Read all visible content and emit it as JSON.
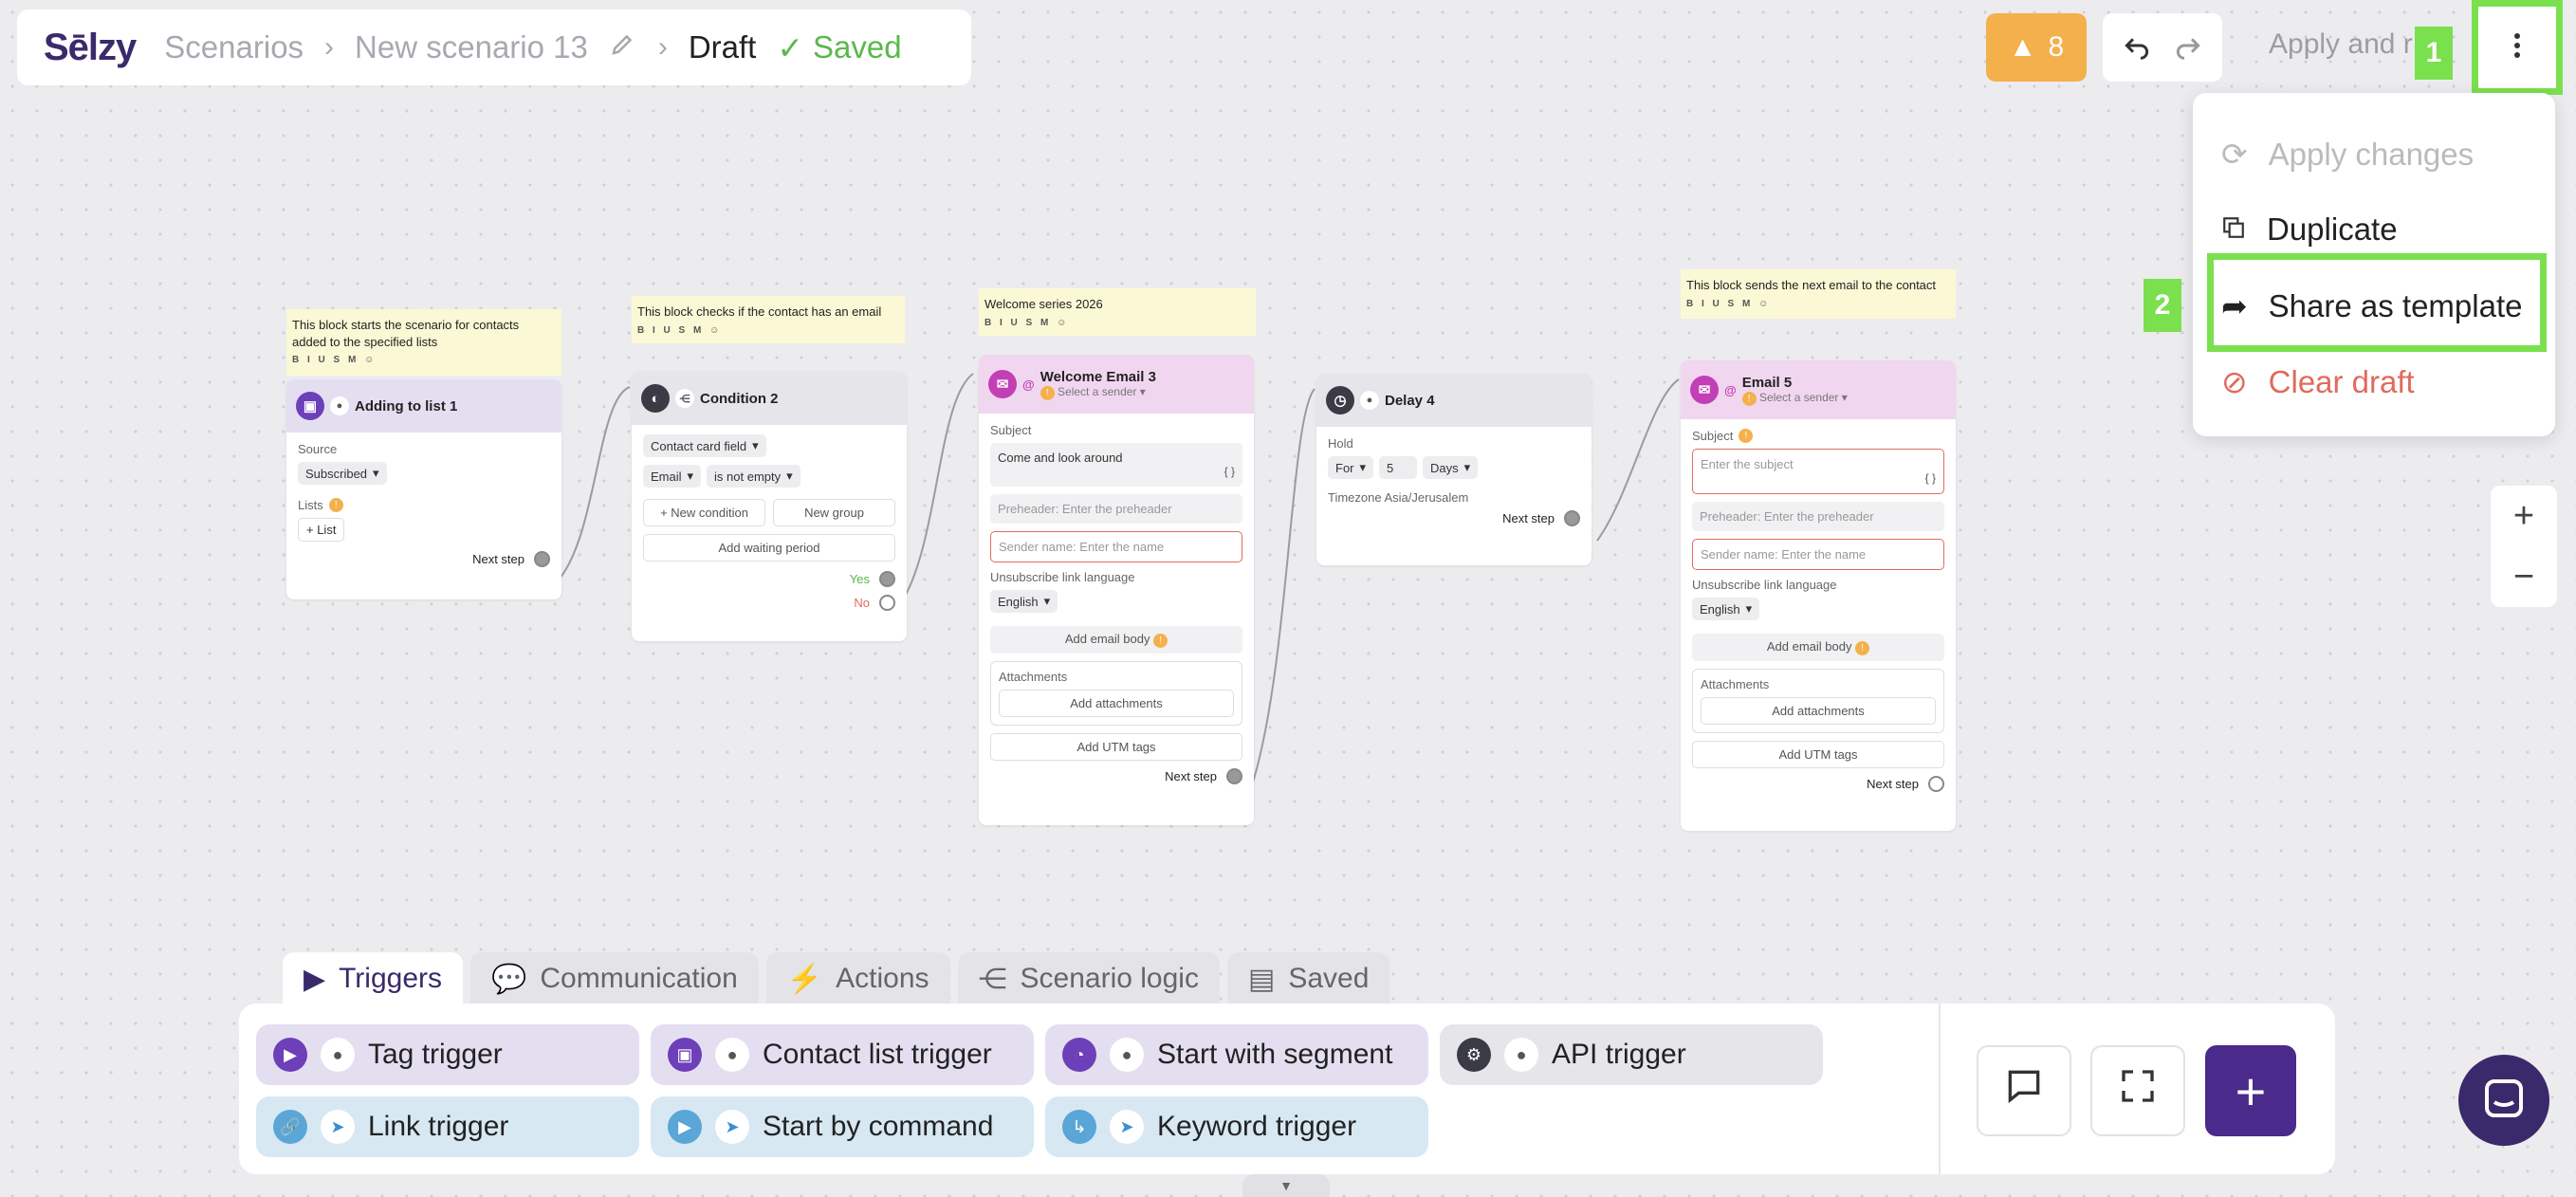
{
  "header": {
    "logo": "Sēlzy",
    "breadcrumb_scenarios": "Scenarios",
    "scenario_name": "New scenario 13",
    "status_draft": "Draft",
    "status_saved": "Saved",
    "warnings_count": "8",
    "apply_label": "Apply and r"
  },
  "annotations": {
    "step1": "1",
    "step2": "2"
  },
  "menu": {
    "apply_changes": "Apply changes",
    "duplicate": "Duplicate",
    "share_as_template": "Share as template",
    "clear_draft": "Clear draft"
  },
  "zoom": {
    "in": "+",
    "out": "−"
  },
  "note_tools": "B I U S M ☺",
  "blocks": {
    "list": {
      "note": "This block starts the scenario for contacts added to the specified lists",
      "title": "Adding to list 1",
      "source_label": "Source",
      "source_value": "Subscribed",
      "lists_label": "Lists",
      "add_list": "+ List",
      "next": "Next step"
    },
    "condition": {
      "note": "This block checks if the contact has an email",
      "title": "Condition 2",
      "field": "Contact card field",
      "subfield": "Email",
      "operator": "is not empty",
      "new_condition": "+ New condition",
      "new_group": "New group",
      "add_wait": "Add waiting period",
      "yes": "Yes",
      "no": "No"
    },
    "email3": {
      "note": "Welcome series 2026",
      "title": "Welcome Email 3",
      "sender": "Select a sender",
      "subject_label": "Subject",
      "subject_value": "Come and look around",
      "preheader": "Preheader: Enter the preheader",
      "sender_name": "Sender name: Enter the name",
      "unsub_label": "Unsubscribe link language",
      "lang": "English",
      "add_body": "Add email body",
      "attachments": "Attachments",
      "add_attachments": "Add attachments",
      "utm": "Add UTM tags",
      "next": "Next step"
    },
    "delay": {
      "title": "Delay 4",
      "hold_label": "Hold",
      "for": "For",
      "amount": "5",
      "unit": "Days",
      "timezone": "Timezone Asia/Jerusalem",
      "next": "Next step"
    },
    "email5": {
      "note": "This block sends the next email to the contact",
      "title": "Email 5",
      "sender": "Select a sender",
      "subject_label": "Subject",
      "subject_placeholder": "Enter the subject",
      "preheader": "Preheader: Enter the preheader",
      "sender_name": "Sender name: Enter the name",
      "unsub_label": "Unsubscribe link language",
      "lang": "English",
      "add_body": "Add email body",
      "attachments": "Attachments",
      "add_attachments": "Add attachments",
      "utm": "Add UTM tags",
      "next": "Next step"
    }
  },
  "palette": {
    "tabs": [
      "Triggers",
      "Communication",
      "Actions",
      "Scenario logic",
      "Saved"
    ],
    "triggers": [
      "Tag trigger",
      "Contact list trigger",
      "Start with segment",
      "API trigger",
      "Link trigger",
      "Start by command",
      "Keyword trigger"
    ]
  },
  "colors": {
    "accent": "#4a2a8a",
    "highlight": "#7be04e",
    "warning": "#f4b04b",
    "danger": "#e06b5d",
    "success": "#5ab84a"
  }
}
